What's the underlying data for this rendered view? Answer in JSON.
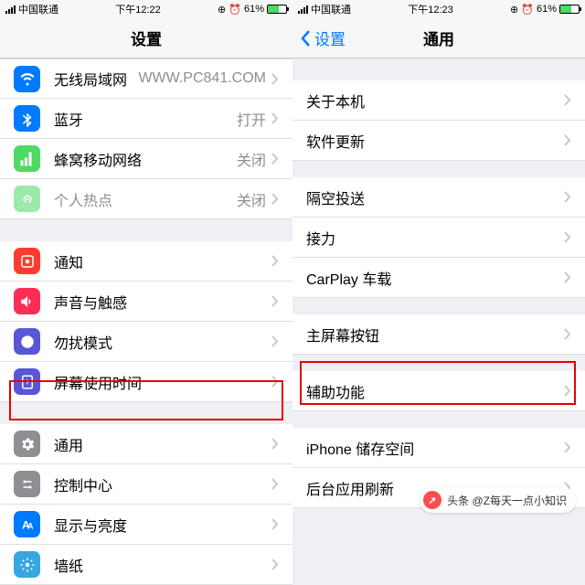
{
  "left": {
    "status": {
      "carrier": "中国联通",
      "time": "下午12:22",
      "battery": "61%"
    },
    "nav": {
      "title": "设置"
    },
    "groups": [
      [
        {
          "icon": "wifi",
          "color": "#007aff",
          "label": "无线局域网",
          "value": "WWW.PC841.COM"
        },
        {
          "icon": "bluetooth",
          "color": "#007aff",
          "label": "蓝牙",
          "value": "打开"
        },
        {
          "icon": "cellular",
          "color": "#4cd964",
          "label": "蜂窝移动网络",
          "value": "关闭"
        },
        {
          "icon": "hotspot",
          "color": "#4cd964",
          "label": "个人热点",
          "value": "关闭",
          "dim": true
        }
      ],
      [
        {
          "icon": "notification",
          "color": "#ff3b30",
          "label": "通知"
        },
        {
          "icon": "sound",
          "color": "#ff2d55",
          "label": "声音与触感"
        },
        {
          "icon": "dnd",
          "color": "#5856d6",
          "label": "勿扰模式"
        },
        {
          "icon": "screentime",
          "color": "#5856d6",
          "label": "屏幕使用时间"
        }
      ],
      [
        {
          "icon": "general",
          "color": "#8e8e93",
          "label": "通用"
        },
        {
          "icon": "control",
          "color": "#8e8e93",
          "label": "控制中心"
        },
        {
          "icon": "display",
          "color": "#007aff",
          "label": "显示与亮度"
        },
        {
          "icon": "wallpaper",
          "color": "#36a7e0",
          "label": "墙纸"
        }
      ]
    ]
  },
  "right": {
    "status": {
      "carrier": "中国联通",
      "time": "下午12:23",
      "battery": "61%"
    },
    "nav": {
      "back": "设置",
      "title": "通用"
    },
    "groups": [
      [
        {
          "label": "关于本机"
        },
        {
          "label": "软件更新"
        }
      ],
      [
        {
          "label": "隔空投送"
        },
        {
          "label": "接力"
        },
        {
          "label": "CarPlay 车载"
        }
      ],
      [
        {
          "label": "主屏幕按钮"
        }
      ],
      [
        {
          "label": "辅助功能"
        }
      ],
      [
        {
          "label": "iPhone 储存空间"
        },
        {
          "label": "后台应用刷新"
        }
      ]
    ]
  },
  "watermark": {
    "prefix": "头条",
    "text": "@Z每天一点小知识"
  }
}
